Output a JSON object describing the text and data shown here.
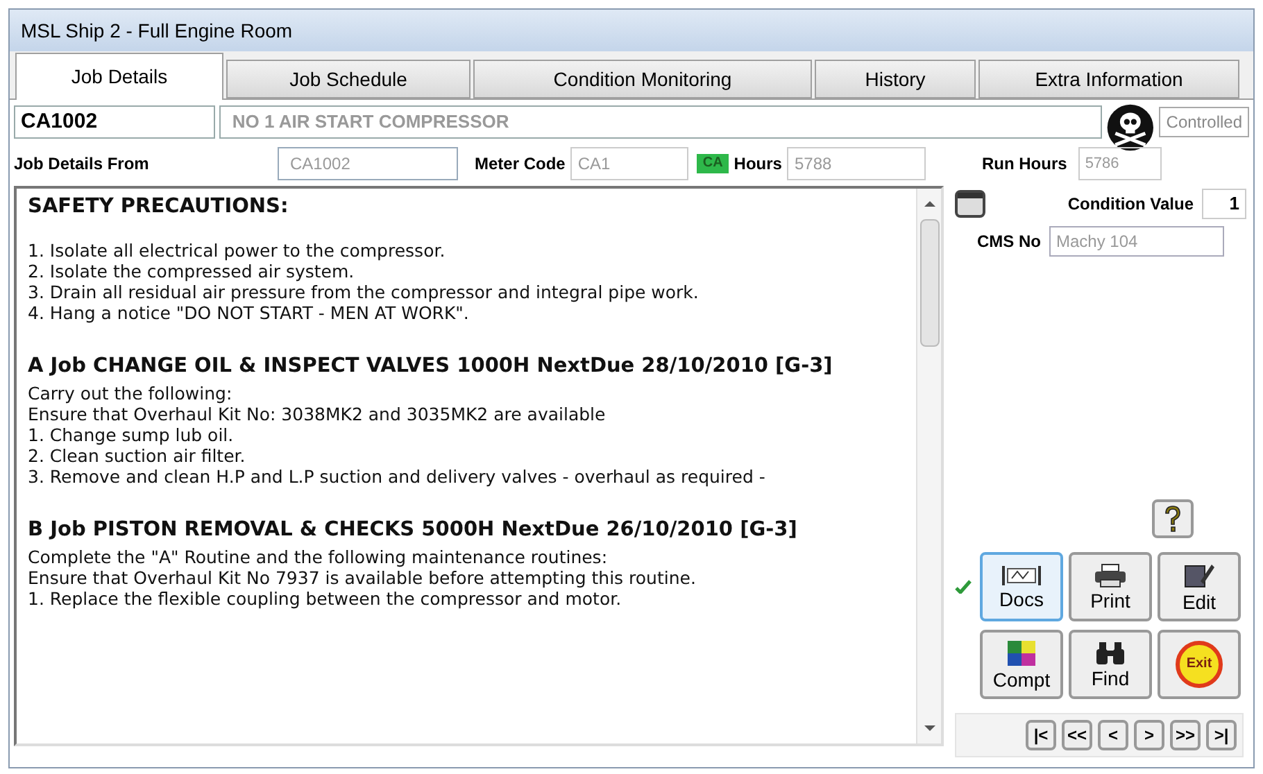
{
  "window": {
    "title": "MSL Ship 2 - Full Engine Room"
  },
  "tabs": [
    {
      "label": "Job Details",
      "selected": true
    },
    {
      "label": "Job Schedule",
      "selected": false
    },
    {
      "label": "Condition Monitoring",
      "selected": false
    },
    {
      "label": "History",
      "selected": false
    },
    {
      "label": "Extra Information",
      "selected": false
    }
  ],
  "job": {
    "code": "CA1002",
    "name": "NO 1 AIR START COMPRESSOR",
    "status": "Controlled"
  },
  "details": {
    "from_label": "Job Details From",
    "from_value": "CA1002",
    "meter_label": "Meter Code",
    "meter_value": "CA1",
    "meter_badge": "CA",
    "hours_label": "Hours",
    "hours_value": "5788",
    "run_hours_label": "Run Hours",
    "run_hours_value": "5786"
  },
  "notes": [
    {
      "heading": "SAFETY PRECAUTIONS:",
      "lines": [
        "1. Isolate all electrical power to the compressor.",
        "2. Isolate the compressed air system.",
        "3. Drain all residual air pressure from the compressor and integral pipe work.",
        "4. Hang a notice \"DO NOT START - MEN AT WORK\"."
      ]
    },
    {
      "heading": "A Job CHANGE OIL & INSPECT VALVES 1000H NextDue 28/10/2010 [G-3]",
      "lines": [
        "Carry out the following:",
        "Ensure that Overhaul Kit No: 3038MK2 and 3035MK2 are available",
        "1. Change sump lub oil.",
        "2. Clean suction air filter.",
        "3. Remove and clean H.P and L.P suction and delivery valves - overhaul as required -"
      ]
    },
    {
      "heading": "B Job PISTON REMOVAL & CHECKS 5000H NextDue 26/10/2010 [G-3]",
      "lines": [
        "Complete the \"A\" Routine and the following maintenance routines:",
        "Ensure that Overhaul Kit No 7937 is available before attempting this routine.",
        "1. Replace the flexible coupling between the compressor and motor."
      ]
    }
  ],
  "condition": {
    "label": "Condition Value",
    "value": "1",
    "cms_label": "CMS No",
    "cms_value": "Machy 104"
  },
  "actions": [
    {
      "kind": "docs",
      "label": "Docs",
      "selected": true
    },
    {
      "kind": "print",
      "label": "Print",
      "selected": false
    },
    {
      "kind": "edit",
      "label": "Edit",
      "selected": false
    },
    {
      "kind": "compt",
      "label": "Compt",
      "selected": false
    },
    {
      "kind": "find",
      "label": "Find",
      "selected": false
    },
    {
      "kind": "exit",
      "label": "Exit",
      "selected": false
    }
  ],
  "navigation": [
    "|<",
    "<<",
    "<",
    ">",
    ">>",
    ">|"
  ]
}
